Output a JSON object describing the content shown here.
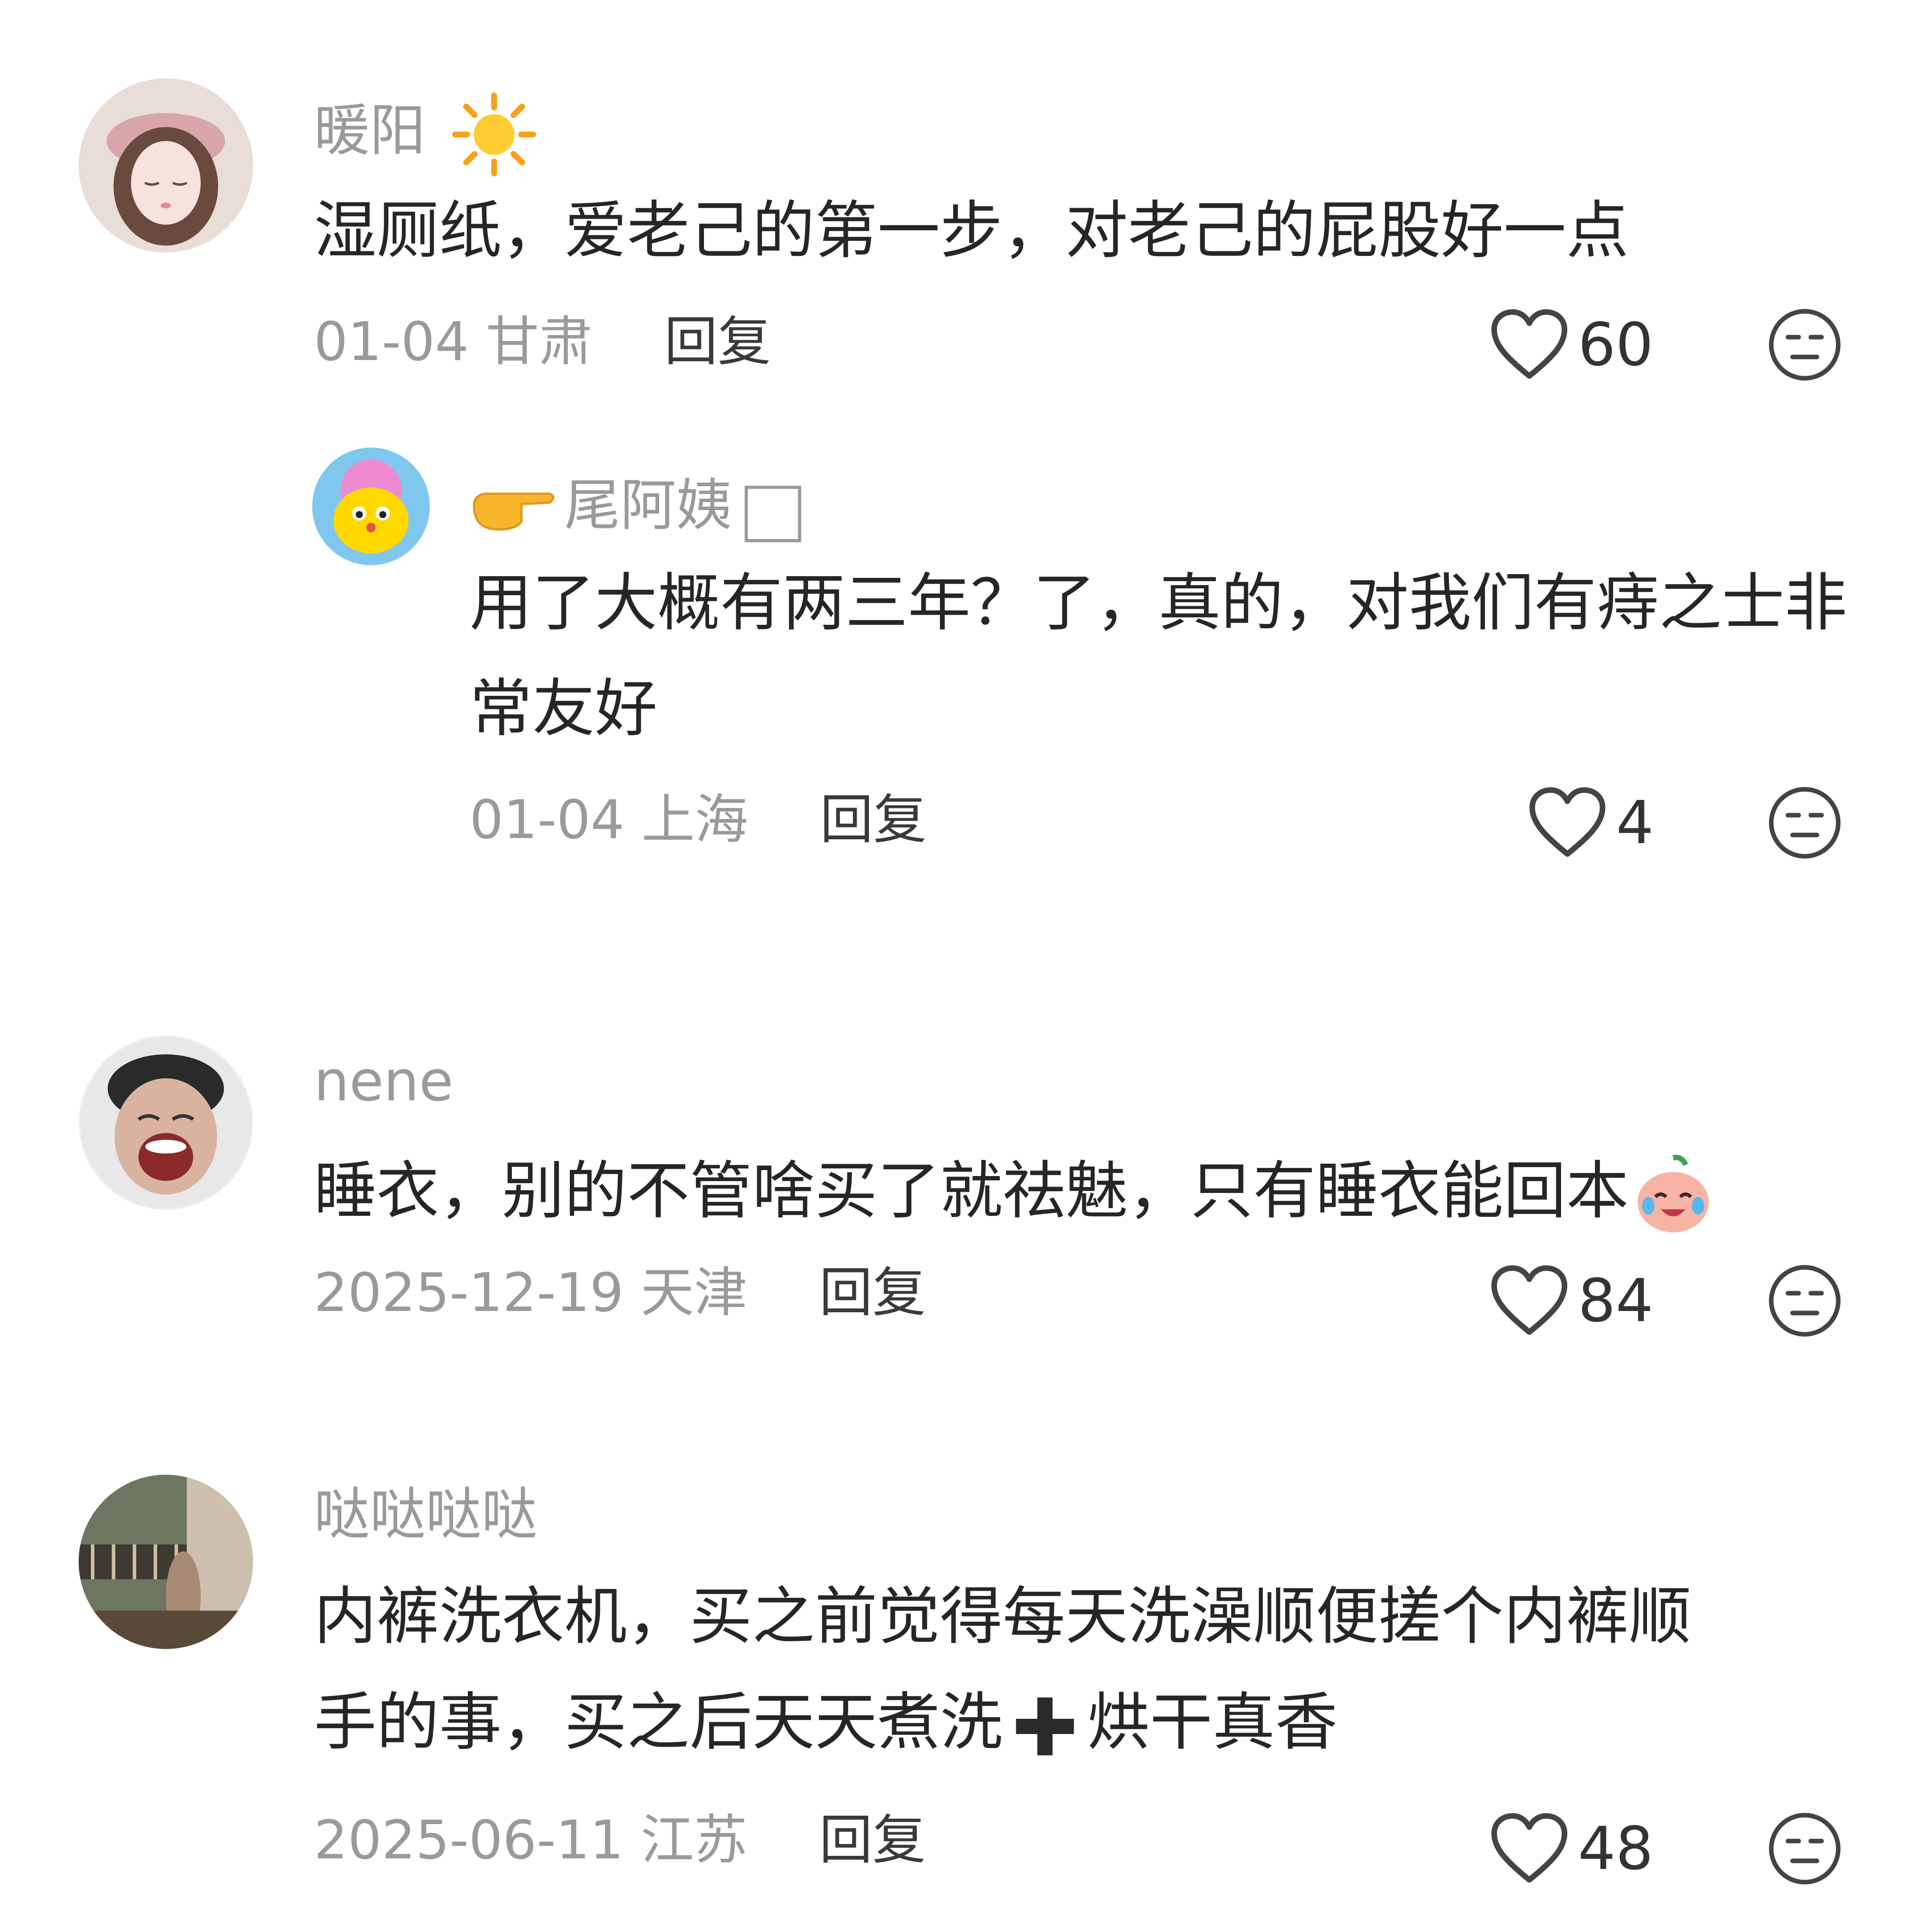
{
  "comments": [
    {
      "username": "暖阳",
      "text": "湿厕纸，爱老己的第一步，对老己的屁股好一点",
      "date": "01-04",
      "location": "甘肃",
      "reply_label": "回复",
      "likes": "60",
      "icons": {
        "username_emoji": "sun-icon",
        "like": "heart-outline-icon",
        "dislike": "unamused-face-icon"
      },
      "replies": [
        {
          "username": "尾阿姨",
          "text": "用了大概有两三年？了，真的，对我们有痔之士非常友好",
          "date": "01-04",
          "location": "上海",
          "reply_label": "回复",
          "likes": "4",
          "icons": {
            "username_prefix": "pointing-hand-icon",
            "username_suffix": "empty-box-icon"
          }
        }
      ]
    },
    {
      "username": "nene",
      "text": "睡衣，别的不管啥买了就祛魅，只有睡衣能回本",
      "date": "2025-12-19",
      "location": "天津",
      "reply_label": "回复",
      "likes": "84",
      "icons": {
        "text_emoji": "crying-laughing-peach-icon"
      }
    },
    {
      "username": "哒哒哒哒",
      "text_line1": "内裤洗衣机，买之前觉得每天洗澡顺便搓个内裤顺",
      "text_line2_a": "手的事，买之后天天煮洗",
      "text_line2_b": "烘干真香",
      "date": "2025-06-11",
      "location": "江苏",
      "reply_label": "回复",
      "likes": "48",
      "icons": {
        "text_emoji": "plus-icon"
      }
    }
  ]
}
